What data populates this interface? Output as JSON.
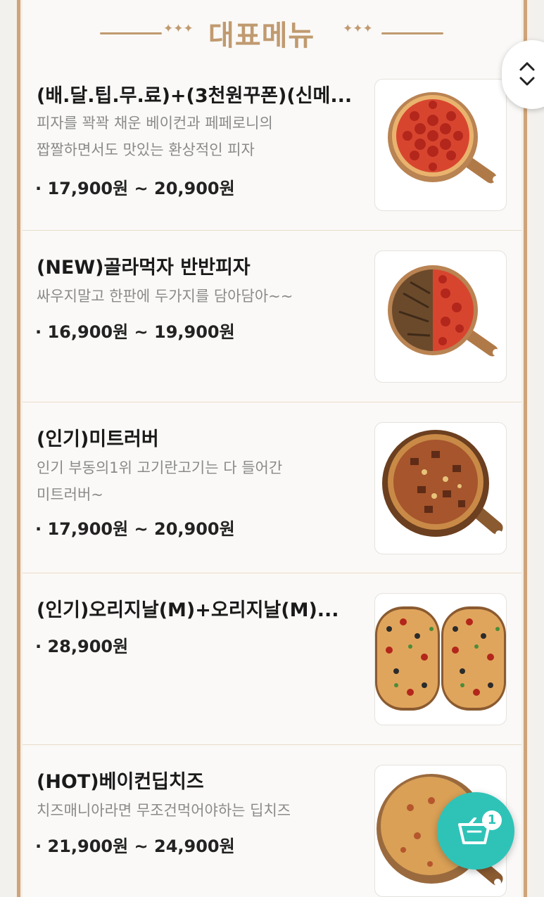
{
  "section": {
    "title": "대표메뉴",
    "ornament_left": "✦✦✦",
    "ornament_right": "✦✦✦"
  },
  "menu": {
    "items": [
      {
        "name": "(배.달.팁.무.료)+(3천원꾸폰)(신메...",
        "desc_lines": [
          "피자를 꽉꽉 채운 베이컨과 페페로니의",
          "짭짤하면서도 맛있는 환상적인 피자"
        ],
        "price": "17,900원 ~ 20,900원",
        "image": "pepperoni-pizza"
      },
      {
        "name": "(NEW)골라먹자 반반피자",
        "desc_lines": [
          "싸우지말고 한판에 두가지를 담아담아~~"
        ],
        "price": "16,900원 ~ 19,900원",
        "image": "half-half-pizza"
      },
      {
        "name": "(인기)미트러버",
        "desc_lines": [
          "인기 부동의1위 고기란고기는 다 들어간",
          "미트러버~"
        ],
        "price": "17,900원 ~ 20,900원",
        "image": "meat-lover-pizza"
      },
      {
        "name": "(인기)오리지날(M)+오리지날(M)...",
        "desc_lines": [],
        "price": "28,900원",
        "image": "double-original-pizza"
      },
      {
        "name": "(HOT)베이컨딥치즈",
        "desc_lines": [
          "치즈매니아라면 무조건먹어야하는 딥치즈"
        ],
        "price": "21,900원 ~ 24,900원",
        "image": "bacon-cheese-pizza"
      }
    ]
  },
  "cart": {
    "count": "1",
    "icon": "basket-icon"
  },
  "scroll_button": {
    "icon": "chevron-up-down-icon"
  },
  "colors": {
    "accent": "#c09a70",
    "cart": "#2fc3b8",
    "price_text": "#222222",
    "desc_text": "#8a8a8a"
  }
}
